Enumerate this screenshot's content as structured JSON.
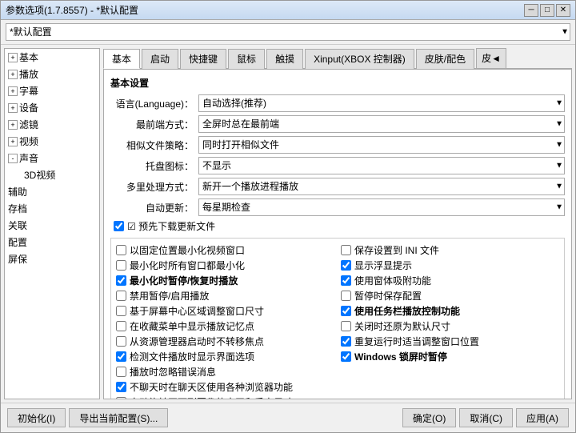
{
  "window": {
    "title": "参数选项(1.7.8557) - *默认配置",
    "close_btn": "✕",
    "min_btn": "─",
    "max_btn": "□"
  },
  "toolbar": {
    "profile_label": "*默认配置",
    "profile_options": [
      "*默认配置"
    ]
  },
  "tabs": [
    {
      "label": "基本",
      "active": true
    },
    {
      "label": "启动"
    },
    {
      "label": "快捷键"
    },
    {
      "label": "鼠标"
    },
    {
      "label": "触摸"
    },
    {
      "label": "Xinput(XBOX 控制器)"
    },
    {
      "label": "皮肤/配色"
    },
    {
      "label": "皮",
      "more": true
    }
  ],
  "tree": {
    "items": [
      {
        "label": "基本",
        "level": 1,
        "has_children": true
      },
      {
        "label": "播放",
        "level": 1,
        "has_children": true
      },
      {
        "label": "字幕",
        "level": 1,
        "has_children": true
      },
      {
        "label": "设备",
        "level": 1,
        "has_children": true
      },
      {
        "label": "滤镜",
        "level": 1,
        "has_children": true
      },
      {
        "label": "视频",
        "level": 1,
        "has_children": true
      },
      {
        "label": "声音",
        "level": 1,
        "has_children": true
      },
      {
        "label": "3D视频",
        "level": 2
      },
      {
        "label": "辅助",
        "level": 1
      },
      {
        "label": "存档",
        "level": 1
      },
      {
        "label": "关联",
        "level": 1
      },
      {
        "label": "配置",
        "level": 1
      },
      {
        "label": "屏保",
        "level": 1
      }
    ]
  },
  "basic_settings": {
    "section_title": "基本设置",
    "language_label": "语言(Language)：",
    "language_value": "自动选择(推荐)",
    "language_options": [
      "自动选择(推荐)"
    ],
    "foreground_label": "最前端方式：",
    "foreground_value": "全屏时总在最前端",
    "foreground_options": [
      "全屏时总在最前端"
    ],
    "similar_file_label": "相似文件策略：",
    "similar_file_value": "同时打开相似文件",
    "similar_file_options": [
      "同时打开相似文件"
    ],
    "tray_icon_label": "托盘图标：",
    "tray_icon_value": "不显示",
    "tray_icon_options": [
      "不显示"
    ],
    "multi_process_label": "多里处理方式：",
    "multi_process_value": "新开一个播放进程播放",
    "multi_process_options": [
      "新开一个播放进程播放"
    ],
    "auto_update_label": "自动更新：",
    "auto_update_value": "每星期检查",
    "auto_update_options": [
      "每星期检查"
    ],
    "pre_download_label": "☑ 预先下载更新文件"
  },
  "checkboxes": [
    {
      "id": "cb1",
      "label": "以固定位置最小化视频窗口",
      "checked": false,
      "bold": false,
      "col": 1
    },
    {
      "id": "cb2",
      "label": "保存设置到 INI 文件",
      "checked": false,
      "bold": false,
      "col": 2
    },
    {
      "id": "cb3",
      "label": "最小化时所有窗口都最小化",
      "checked": false,
      "bold": false,
      "col": 1
    },
    {
      "id": "cb4",
      "label": "显示浮显提示",
      "checked": true,
      "bold": false,
      "col": 2
    },
    {
      "id": "cb5",
      "label": "最小化时暂停/恢复时播放",
      "checked": true,
      "bold": true,
      "col": 1
    },
    {
      "id": "cb6",
      "label": "使用窗体吸附功能",
      "checked": true,
      "bold": false,
      "col": 2
    },
    {
      "id": "cb7",
      "label": "禁用暂停/启用播放",
      "checked": false,
      "bold": false,
      "col": 1
    },
    {
      "id": "cb8",
      "label": "暂停时保存配置",
      "checked": false,
      "bold": false,
      "col": 2
    },
    {
      "id": "cb9",
      "label": "基于屏幕中心区域调整窗口尺寸",
      "checked": false,
      "bold": false,
      "col": 1
    },
    {
      "id": "cb10",
      "label": "使用任务栏播放控制功能",
      "checked": true,
      "bold": true,
      "col": 2
    },
    {
      "id": "cb11",
      "label": "在收藏菜单中显示播放记忆点",
      "checked": false,
      "bold": false,
      "col": 1
    },
    {
      "id": "cb12",
      "label": "关闭时还原为默认尺寸",
      "checked": false,
      "bold": false,
      "col": 2
    },
    {
      "id": "cb13",
      "label": "从资源管理器启动时不转移焦点",
      "checked": false,
      "bold": false,
      "col": 1
    },
    {
      "id": "cb14",
      "label": "重复运行时适当调整窗口位置",
      "checked": true,
      "bold": false,
      "col": 2
    },
    {
      "id": "cb15",
      "label": "✔ 检测文件播放时显示界面选项",
      "checked": true,
      "bold": false,
      "col": 1
    },
    {
      "id": "cb16",
      "label": "Windows 锁屏时暂停",
      "checked": true,
      "bold": true,
      "col": 2
    },
    {
      "id": "cb17",
      "label": "播放时忽略错误消息",
      "checked": false,
      "bold": false,
      "col": 1
    },
    {
      "id": "cb18",
      "label": "",
      "checked": false,
      "bold": false,
      "col": 2
    },
    {
      "id": "cb19",
      "label": "✔ 不聊天时在聊天区使用各种浏览器功能",
      "checked": true,
      "bold": false,
      "col": 1
    },
    {
      "id": "cb20",
      "label": "",
      "checked": false,
      "bold": false,
      "col": 2
    },
    {
      "id": "cb21",
      "label": "自动旋转画面到图像的水平和垂直尺寸",
      "checked": false,
      "bold": false,
      "col": 1
    }
  ],
  "bottom_buttons": {
    "init_label": "初始化(I)",
    "export_label": "导出当前配置(S)...",
    "ok_label": "确定(O)",
    "cancel_label": "取消(C)",
    "apply_label": "应用(A)"
  }
}
